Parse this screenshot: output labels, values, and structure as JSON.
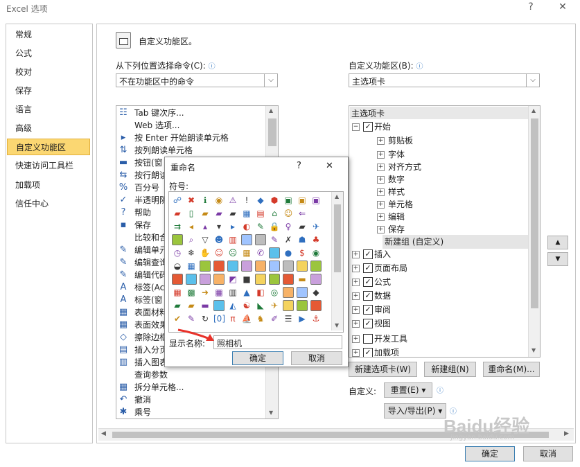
{
  "window": {
    "title": "Excel 选项",
    "help": "?",
    "close": "✕"
  },
  "nav": {
    "items": [
      {
        "label": "常规",
        "selected": false
      },
      {
        "label": "公式",
        "selected": false
      },
      {
        "label": "校对",
        "selected": false
      },
      {
        "label": "保存",
        "selected": false
      },
      {
        "label": "语言",
        "selected": false
      },
      {
        "label": "高级",
        "selected": false
      },
      {
        "label": "自定义功能区",
        "selected": true
      },
      {
        "label": "快速访问工具栏",
        "selected": false
      },
      {
        "label": "加载项",
        "selected": false
      },
      {
        "label": "信任中心",
        "selected": false
      }
    ]
  },
  "main": {
    "heading": "自定义功能区。",
    "left_label": "从下列位置选择命令(C):",
    "left_combo_value": "不在功能区中的命令",
    "right_label": "自定义功能区(B):",
    "right_combo_value": "主选项卡"
  },
  "commands": [
    {
      "icon": "☷",
      "label": "Tab 键次序..."
    },
    {
      "icon": "",
      "label": "Web 选项..."
    },
    {
      "icon": "▸",
      "label": "按 Enter 开始朗读单元格"
    },
    {
      "icon": "⇅",
      "label": "按列朗读单元格"
    },
    {
      "icon": "▬",
      "label": "按钮(窗"
    },
    {
      "icon": "⇆",
      "label": "按行朗读"
    },
    {
      "icon": "%",
      "label": "百分号"
    },
    {
      "icon": "✓",
      "label": "半透明阴"
    },
    {
      "icon": "?",
      "label": "帮助"
    },
    {
      "icon": "▪",
      "label": "保存"
    },
    {
      "icon": "",
      "label": "比较和合"
    },
    {
      "icon": "✎",
      "label": "编辑单元"
    },
    {
      "icon": "✎",
      "label": "编辑查询"
    },
    {
      "icon": "✎",
      "label": "编辑代码"
    },
    {
      "icon": "A",
      "label": "标签(Ac"
    },
    {
      "icon": "A",
      "label": "标签(窗"
    },
    {
      "icon": "▦",
      "label": "表面材料"
    },
    {
      "icon": "▦",
      "label": "表面效果"
    },
    {
      "icon": "◇",
      "label": "擦除边框"
    },
    {
      "icon": "▤",
      "label": "插入分页"
    },
    {
      "icon": "▥",
      "label": "插入图表"
    },
    {
      "icon": "",
      "label": "查询参数"
    },
    {
      "icon": "▦",
      "label": "拆分单元格..."
    },
    {
      "icon": "↶",
      "label": "撤消"
    },
    {
      "icon": "✱",
      "label": "乘号"
    }
  ],
  "tree": {
    "header": "主选项卡",
    "items": [
      {
        "level": 0,
        "expander": "⊟",
        "checked": true,
        "label": "开始"
      },
      {
        "level": 1,
        "expander": "⊞",
        "checked": null,
        "label": "剪贴板"
      },
      {
        "level": 1,
        "expander": "⊞",
        "checked": null,
        "label": "字体"
      },
      {
        "level": 1,
        "expander": "⊞",
        "checked": null,
        "label": "对齐方式"
      },
      {
        "level": 1,
        "expander": "⊞",
        "checked": null,
        "label": "数字"
      },
      {
        "level": 1,
        "expander": "⊞",
        "checked": null,
        "label": "样式"
      },
      {
        "level": 1,
        "expander": "⊞",
        "checked": null,
        "label": "单元格"
      },
      {
        "level": 1,
        "expander": "⊞",
        "checked": null,
        "label": "编辑"
      },
      {
        "level": 1,
        "expander": "⊞",
        "checked": null,
        "label": "保存"
      },
      {
        "level": 1,
        "expander": "",
        "checked": null,
        "label": "新建组 (自定义)",
        "selected": true
      },
      {
        "level": 0,
        "expander": "⊞",
        "checked": true,
        "label": "插入"
      },
      {
        "level": 0,
        "expander": "⊞",
        "checked": true,
        "label": "页面布局"
      },
      {
        "level": 0,
        "expander": "⊞",
        "checked": true,
        "label": "公式"
      },
      {
        "level": 0,
        "expander": "⊞",
        "checked": true,
        "label": "数据"
      },
      {
        "level": 0,
        "expander": "⊞",
        "checked": true,
        "label": "审阅"
      },
      {
        "level": 0,
        "expander": "⊞",
        "checked": true,
        "label": "视图"
      },
      {
        "level": 0,
        "expander": "⊞",
        "checked": false,
        "label": "开发工具"
      },
      {
        "level": 0,
        "expander": "⊞",
        "checked": true,
        "label": "加载项"
      }
    ]
  },
  "buttons": {
    "new_tab": "新建选项卡(W)",
    "new_group": "新建组(N)",
    "rename": "重命名(M)...",
    "customize_label": "自定义:",
    "reset": "重置(E) ▾",
    "import_export": "导入/导出(P) ▾",
    "ok": "确定",
    "cancel": "取消",
    "move_up": "▲",
    "move_down": "▼"
  },
  "dialog": {
    "title": "重命名",
    "help": "?",
    "close": "✕",
    "symbol_label": "符号:",
    "display_name_label": "显示名称:",
    "display_name_value": "照相机",
    "ok": "确定",
    "cancel": "取消",
    "symbols": [
      [
        "☍",
        "✖",
        "ℹ",
        "◉",
        "⚠",
        "!",
        "◆",
        "⬢",
        "▣",
        "▣",
        "▣"
      ],
      [
        "▰",
        "▯",
        "▰",
        "▰",
        "▰",
        "▦",
        "▤",
        "⌂",
        "☺",
        "⇐",
        ""
      ],
      [
        "⇉",
        "◂",
        "▴",
        "▾",
        "▸",
        "◐",
        "✎",
        "🔒",
        "♀",
        "▰",
        "✈"
      ],
      [
        "▭",
        "⌕",
        "▽",
        "☻",
        "▥",
        "▭",
        "▭",
        "✎",
        "✗",
        "☗",
        "♣"
      ],
      [
        "◷",
        "❄",
        "✋",
        "☺",
        "☹",
        "▦",
        "✆",
        "▭",
        "●",
        "$",
        "◉"
      ],
      [
        "◒",
        "▦",
        "▭",
        "▭",
        "▭",
        "▭",
        "▭",
        "▭",
        "▭",
        "▭",
        "▭"
      ],
      [
        "▭",
        "▭",
        "▭",
        "▭",
        "◩",
        "■",
        "▭",
        "▭",
        "▭",
        "▬",
        "▭"
      ],
      [
        "▦",
        "▩",
        "➜",
        "▦",
        "▥",
        "▲",
        "◧",
        "◎",
        "▭",
        "▭",
        "◆"
      ],
      [
        "▰",
        "▰",
        "▬",
        "▭",
        "◭",
        "☯",
        "◣",
        "✈",
        "▭",
        "▭",
        "▭"
      ],
      [
        "✔",
        "✎",
        "↻",
        "[0]",
        "π",
        "⛵",
        "♞",
        "✐",
        "☰",
        "▶",
        "⚓"
      ]
    ]
  },
  "watermark": {
    "brand": "Baidu经验",
    "url": "jingyan.baidu.com"
  }
}
